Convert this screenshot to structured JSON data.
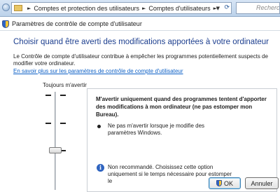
{
  "address_bar": {
    "breadcrumbs": [
      "Comptes et protection des utilisateurs",
      "Comptes d'utilisateurs"
    ],
    "search_placeholder": "Recherc"
  },
  "dialog": {
    "title": "Paramètres de contrôle de compte d'utilisateur",
    "heading": "Choisir quand être averti des modifications apportées à votre ordinateur",
    "description": "Le Contrôle de compte d'utilisateur contribue à empêcher les programmes potentiellement suspects de modifier votre ordinateur.",
    "learn_more_link": "En savoir plus sur les paramètres de contrôle de compte d'utilisateur",
    "slider": {
      "top_label": "Toujours m'avertir",
      "levels": 4,
      "selected_level": 2
    },
    "info_panel": {
      "title": "M'avertir uniquement quand des programmes tentent d'apporter des modifications à mon ordinateur (ne pas estomper mon Bureau).",
      "bullet": "Ne pas m'avertir lorsque je modifie des paramètres Windows.",
      "warning": "Non recommandé. Choisissez cette option uniquement si le temps nécessaire pour estomper le"
    },
    "buttons": {
      "ok": "OK",
      "cancel": "Annuler"
    }
  },
  "colors": {
    "heading": "#1d3f8f",
    "link": "#0b5fc6",
    "address_bar": "#c9dcf0"
  }
}
